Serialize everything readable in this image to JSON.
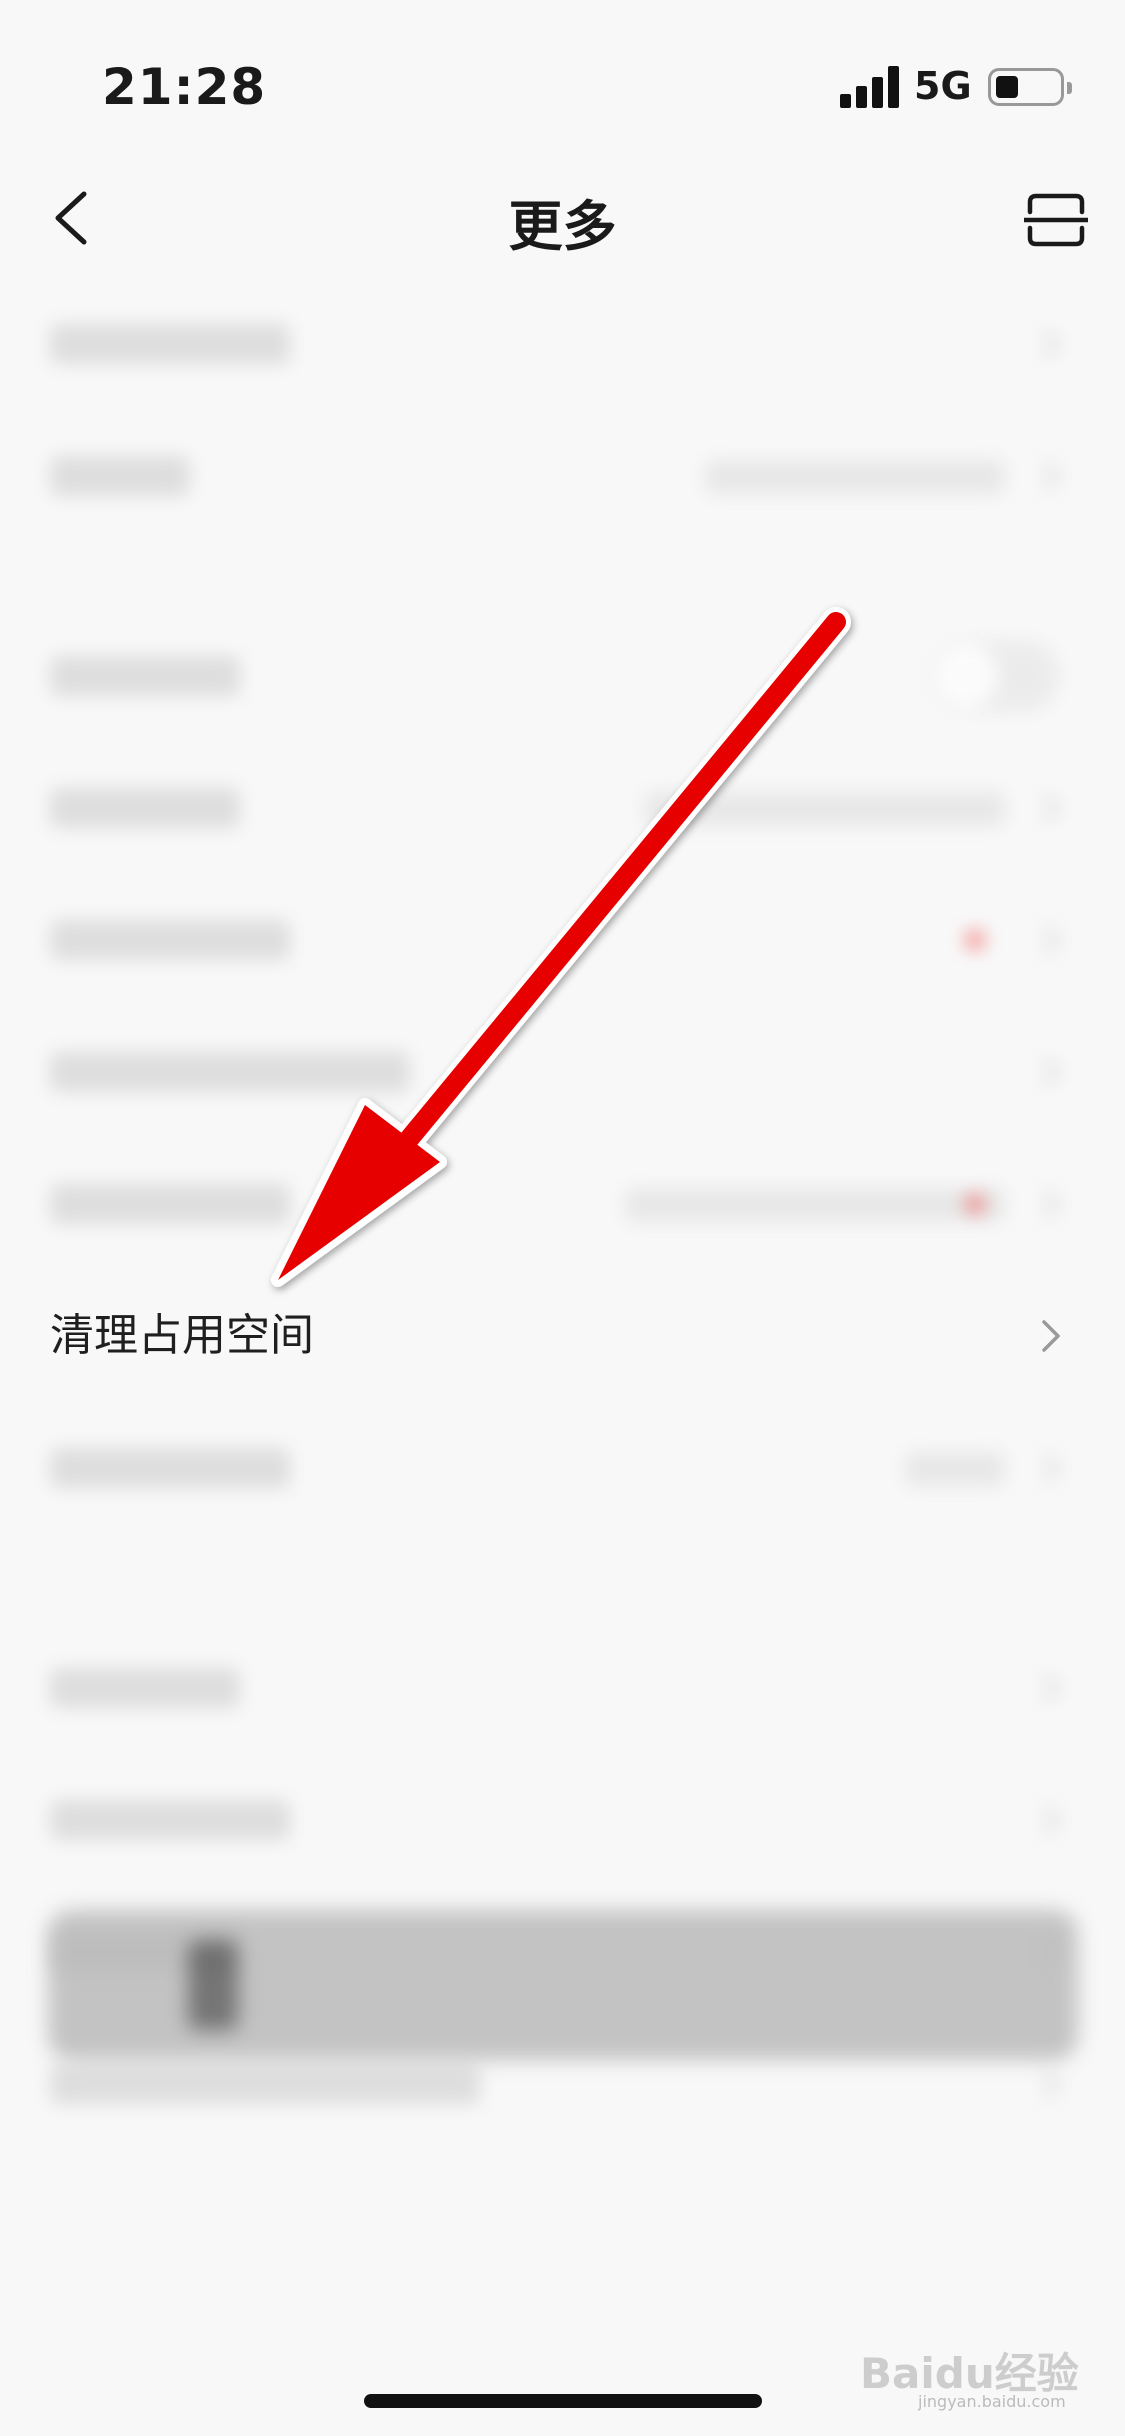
{
  "status_bar": {
    "time": "21:28",
    "network": "5G"
  },
  "nav": {
    "title": "更多"
  },
  "list": {
    "highlighted_item": {
      "label": "清理占用空间"
    }
  },
  "watermark": {
    "brand": "Baidu经验",
    "url": "jingyan.baidu.com"
  },
  "colors": {
    "arrow": "#e60000",
    "background": "#f8f8f8",
    "badge": "#f03c3c"
  }
}
